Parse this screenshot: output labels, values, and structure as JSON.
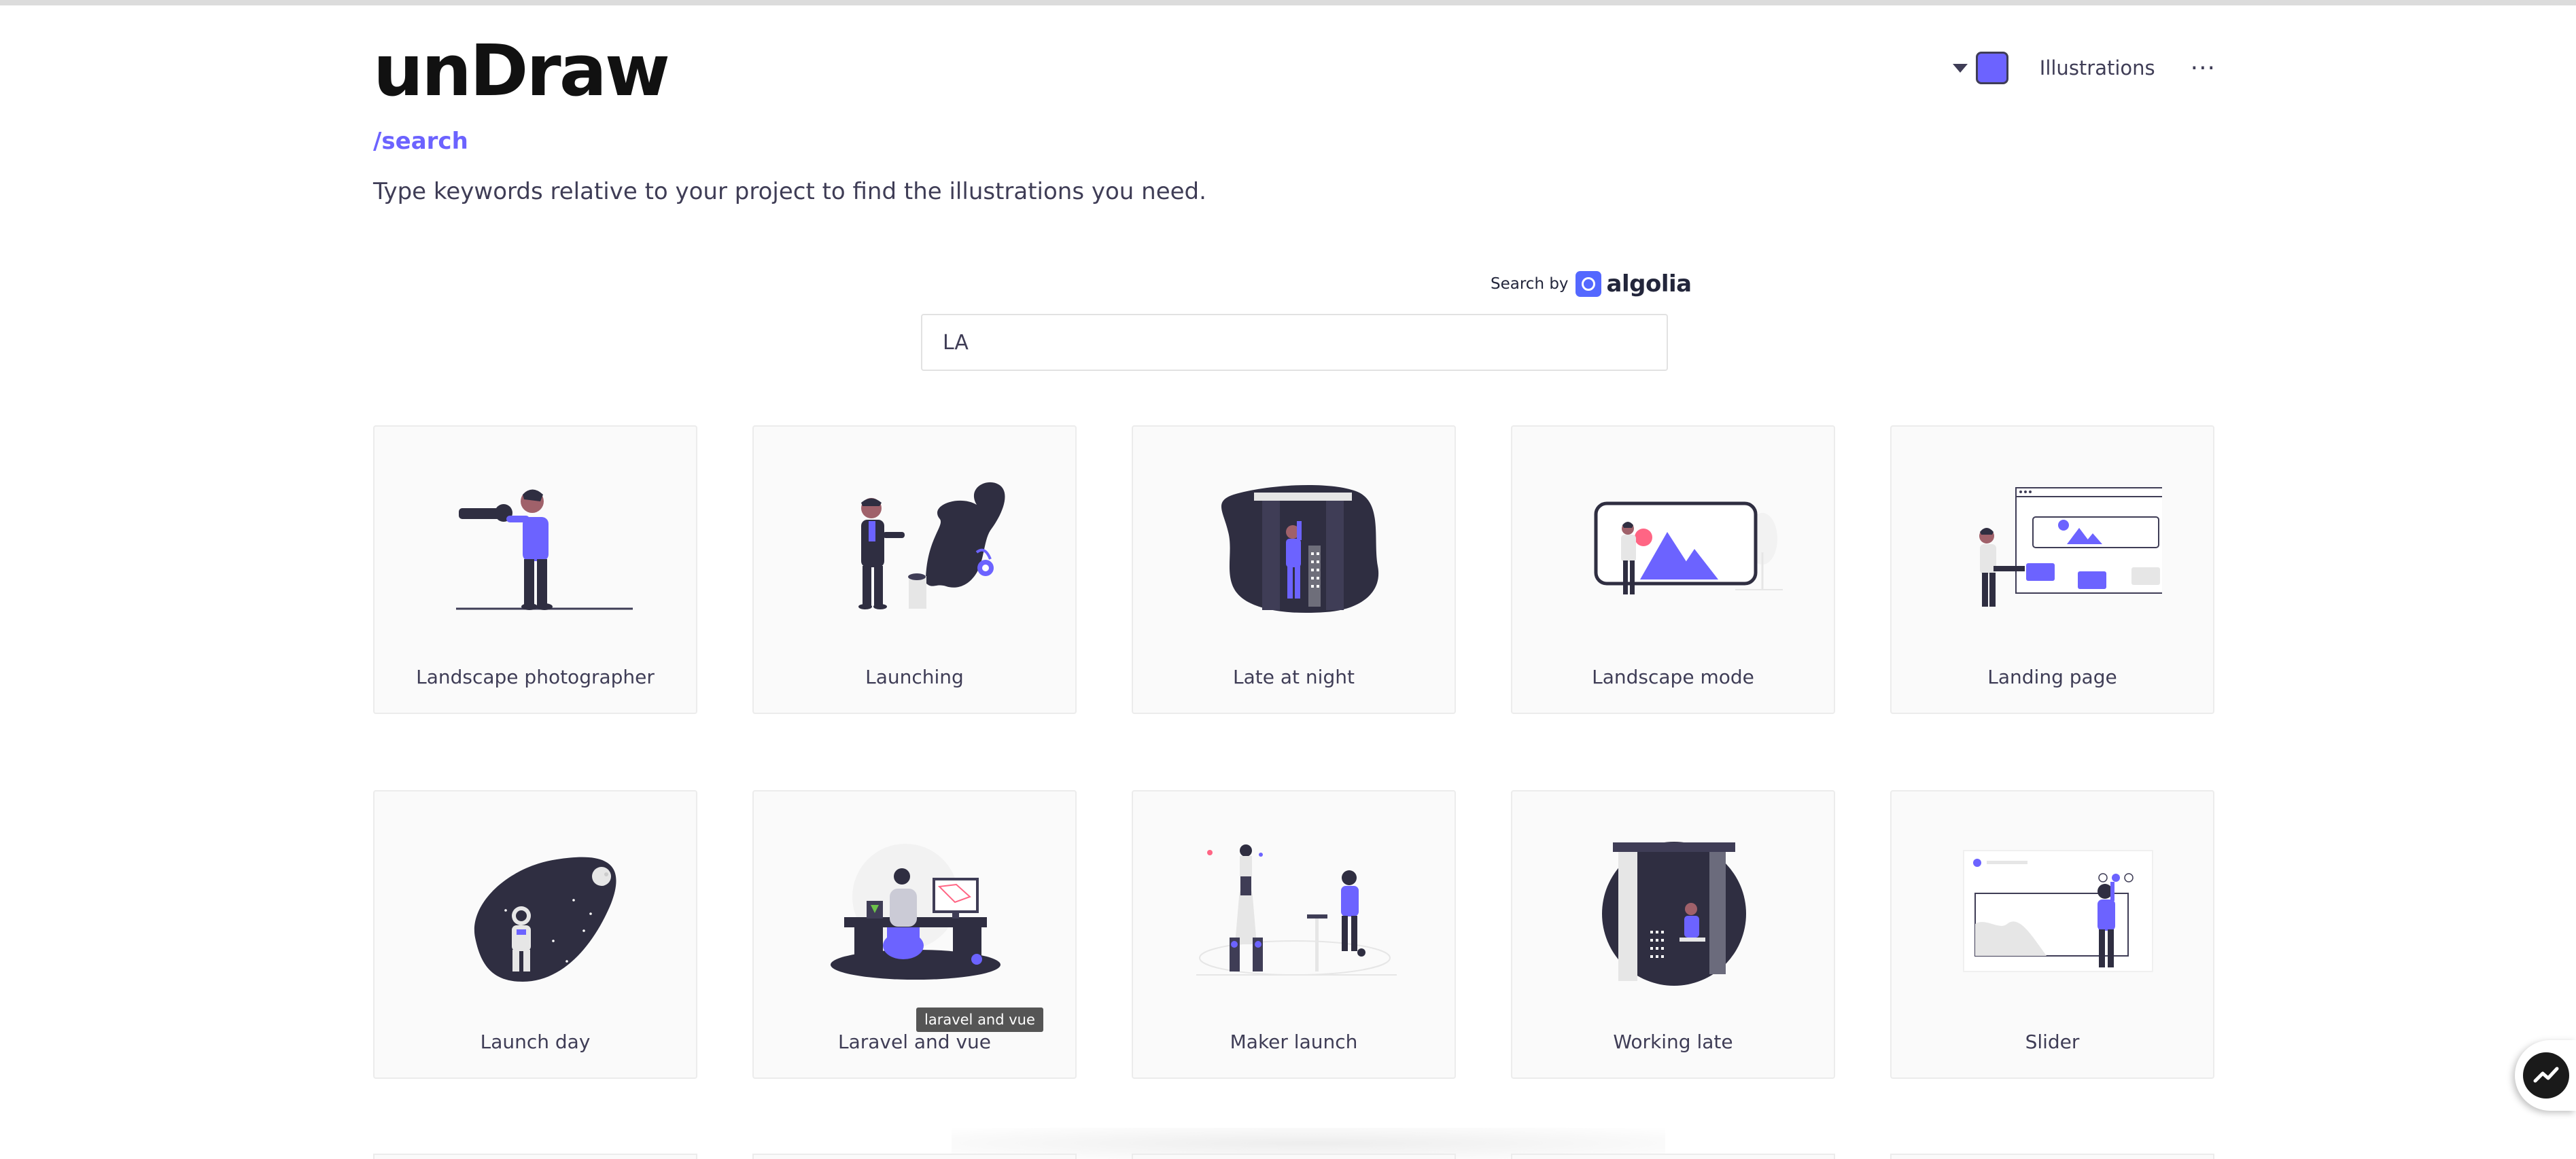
{
  "header": {
    "logo": "unDraw",
    "route": "/search",
    "tagline": "Type keywords relative to your project to find the illustrations you need.",
    "nav": {
      "illustrations_label": "Illustrations",
      "more_label": "···"
    },
    "accent_color": "#6c63ff"
  },
  "search": {
    "powered_by_label": "Search by",
    "powered_by_brand": "algolia",
    "query": "LA"
  },
  "results": [
    {
      "title": "Landscape photographer",
      "icon": "landscape-photographer-illustration"
    },
    {
      "title": "Launching",
      "icon": "launching-illustration"
    },
    {
      "title": "Late at night",
      "icon": "late-at-night-illustration"
    },
    {
      "title": "Landscape mode",
      "icon": "landscape-mode-illustration"
    },
    {
      "title": "Landing page",
      "icon": "landing-page-illustration"
    },
    {
      "title": "Launch day",
      "icon": "launch-day-illustration"
    },
    {
      "title": "Laravel and vue",
      "icon": "laravel-and-vue-illustration"
    },
    {
      "title": "Maker launch",
      "icon": "maker-launch-illustration"
    },
    {
      "title": "Working late",
      "icon": "working-late-illustration"
    },
    {
      "title": "Slider",
      "icon": "slider-illustration"
    }
  ],
  "tooltip": {
    "text": "laravel and vue"
  },
  "chat": {
    "icon": "messenger-icon"
  }
}
